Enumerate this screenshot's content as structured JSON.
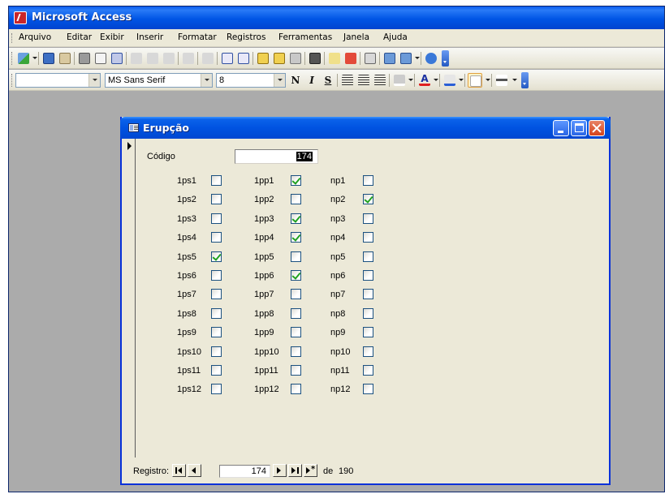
{
  "app": {
    "title": "Microsoft Access"
  },
  "menu": [
    "Arquivo",
    "Editar",
    "Exibir",
    "Inserir",
    "Formatar",
    "Registros",
    "Ferramentas",
    "Janela",
    "Ajuda"
  ],
  "formatting": {
    "font_name": "MS Sans Serif",
    "font_size": "8",
    "bold": "N",
    "italic": "I",
    "underline": "S"
  },
  "form": {
    "title": "Erupção",
    "codigo_label": "Código",
    "codigo_value": "174",
    "ps": [
      {
        "label": "1ps1",
        "checked": false
      },
      {
        "label": "1ps2",
        "checked": false
      },
      {
        "label": "1ps3",
        "checked": false
      },
      {
        "label": "1ps4",
        "checked": false
      },
      {
        "label": "1ps5",
        "checked": true
      },
      {
        "label": "1ps6",
        "checked": false
      },
      {
        "label": "1ps7",
        "checked": false
      },
      {
        "label": "1ps8",
        "checked": false
      },
      {
        "label": "1ps9",
        "checked": false
      },
      {
        "label": "1ps10",
        "checked": false
      },
      {
        "label": "1ps11",
        "checked": false
      },
      {
        "label": "1ps12",
        "checked": false
      }
    ],
    "pp": [
      {
        "label": "1pp1",
        "checked": true
      },
      {
        "label": "1pp2",
        "checked": false
      },
      {
        "label": "1pp3",
        "checked": true
      },
      {
        "label": "1pp4",
        "checked": true
      },
      {
        "label": "1pp5",
        "checked": false
      },
      {
        "label": "1pp6",
        "checked": true
      },
      {
        "label": "1pp7",
        "checked": false
      },
      {
        "label": "1pp8",
        "checked": false
      },
      {
        "label": "1pp9",
        "checked": false
      },
      {
        "label": "1pp10",
        "checked": false
      },
      {
        "label": "1pp11",
        "checked": false
      },
      {
        "label": "1pp12",
        "checked": false
      }
    ],
    "np": [
      {
        "label": "np1",
        "checked": false
      },
      {
        "label": "np2",
        "checked": true
      },
      {
        "label": "np3",
        "checked": false
      },
      {
        "label": "np4",
        "checked": false
      },
      {
        "label": "np5",
        "checked": false
      },
      {
        "label": "np6",
        "checked": false
      },
      {
        "label": "np7",
        "checked": false
      },
      {
        "label": "np8",
        "checked": false
      },
      {
        "label": "np9",
        "checked": false
      },
      {
        "label": "np10",
        "checked": false
      },
      {
        "label": "np11",
        "checked": false
      },
      {
        "label": "np12",
        "checked": false
      }
    ]
  },
  "navigation": {
    "label": "Registro:",
    "current": "174",
    "of_label": "de",
    "total": "190"
  }
}
